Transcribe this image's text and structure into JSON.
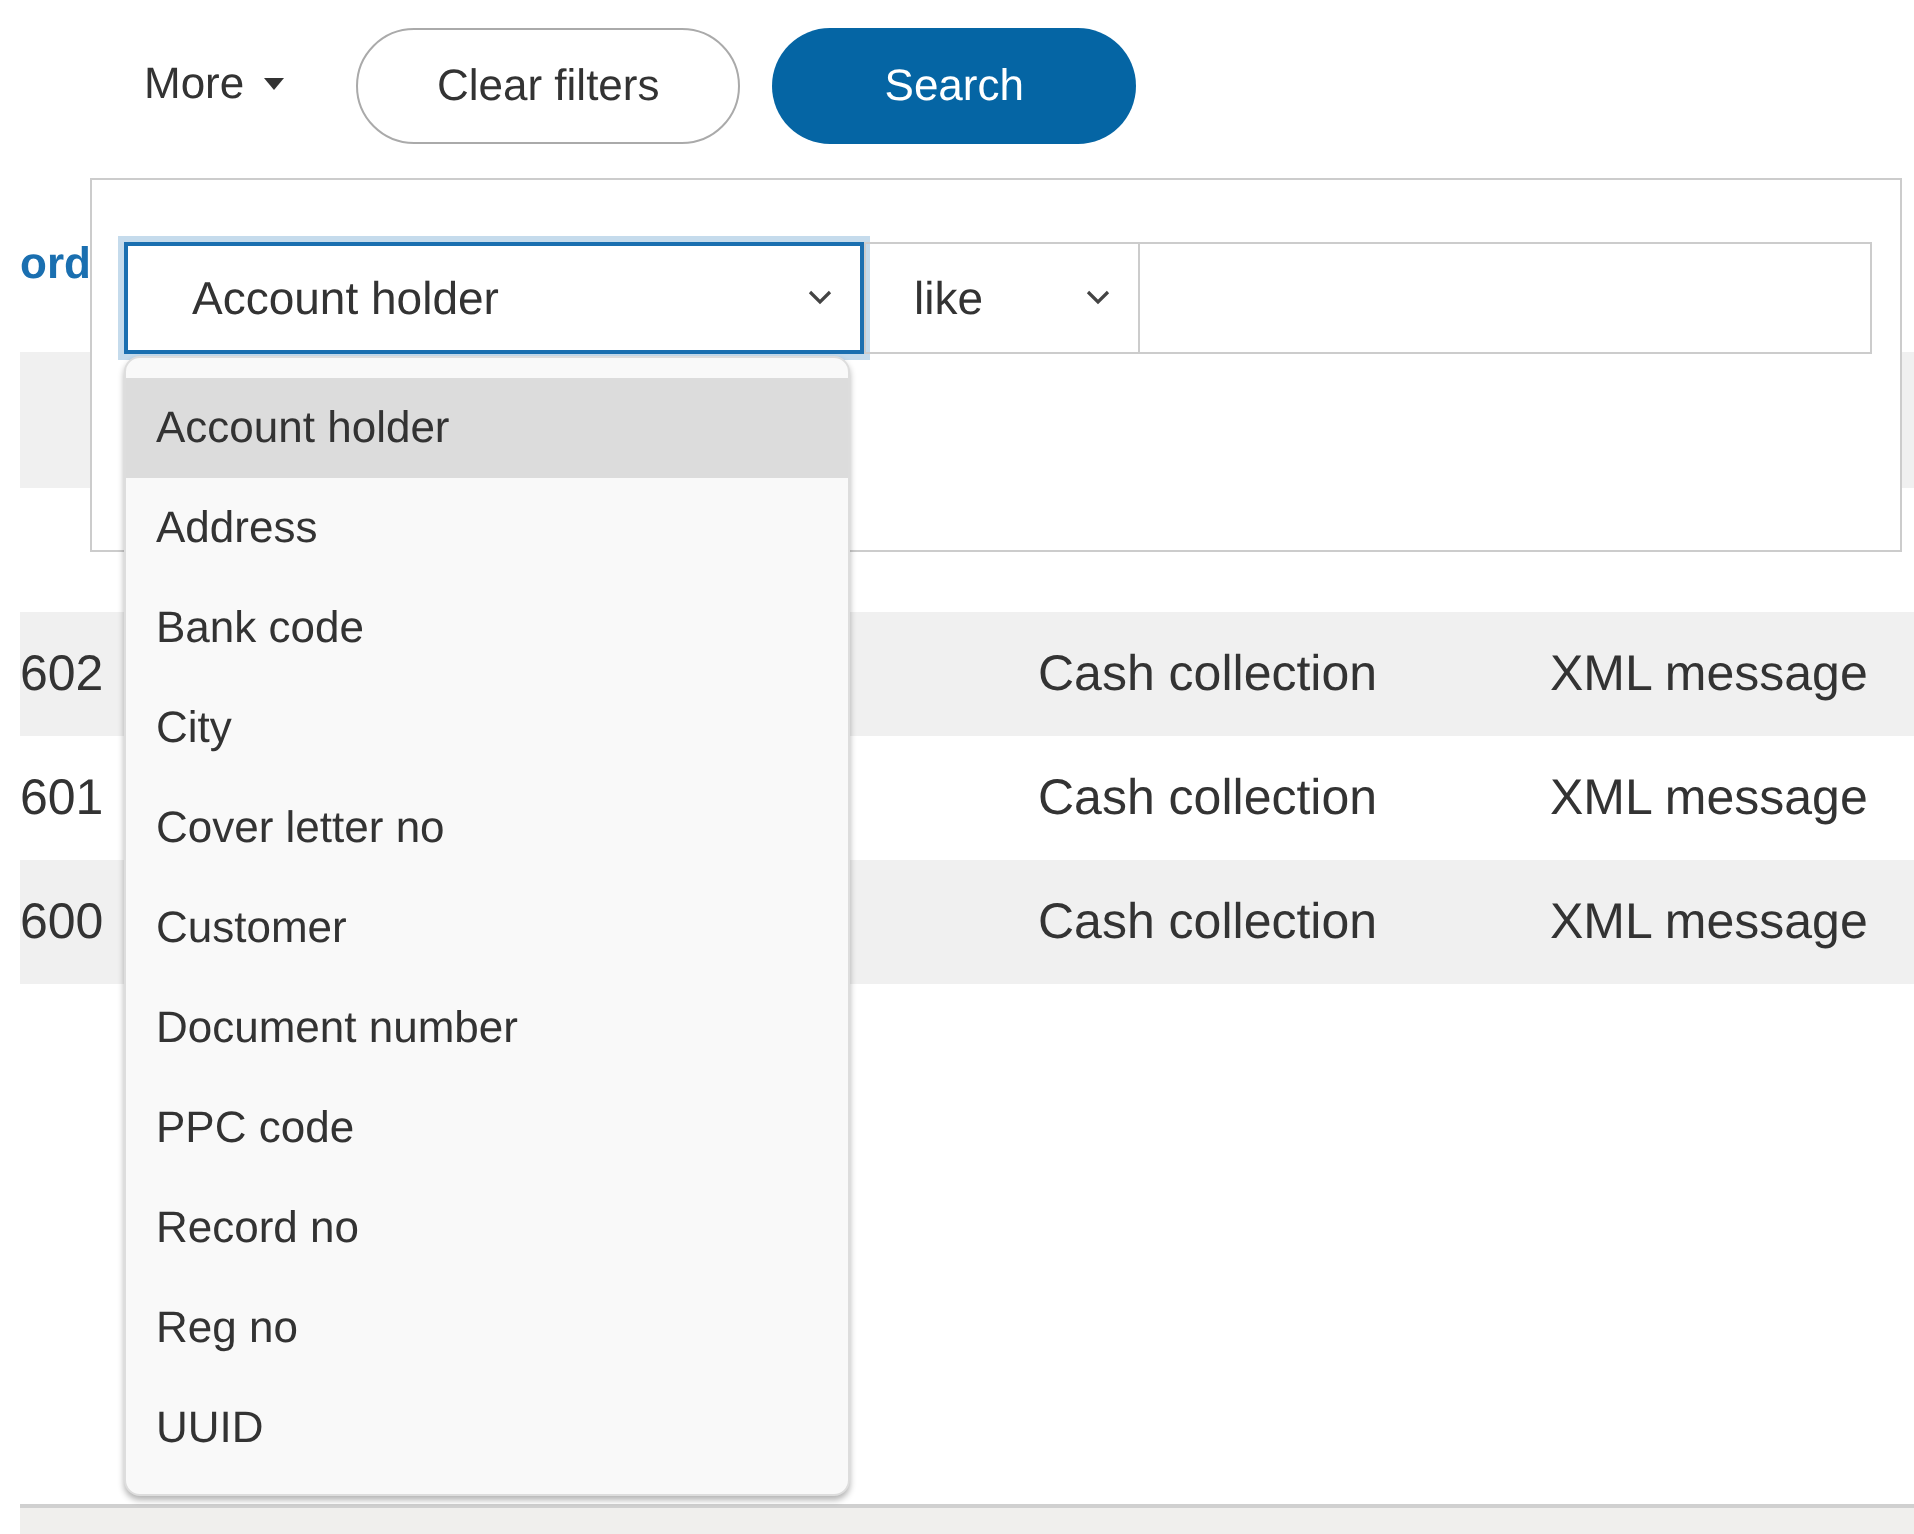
{
  "toolbar": {
    "more": {
      "label": "More"
    },
    "buttons": [
      {
        "label": "Clear filters",
        "kind": "secondary"
      },
      {
        "label": "Search",
        "kind": "primary"
      }
    ]
  },
  "table": {
    "header_link": "ord",
    "rows": [
      {
        "column_1": "602",
        "column_2": "Cash collection",
        "column_3": "XML message",
        "shaded": true
      },
      {
        "column_1": "601",
        "column_2": "Cash collection",
        "column_3": "XML message",
        "shaded": false
      },
      {
        "column_1": "600",
        "column_2": "Cash collection",
        "column_3": "XML message",
        "shaded": true
      }
    ]
  },
  "filter": {
    "field": {
      "value": "Account holder",
      "open": true,
      "options": [
        {
          "label": "Account holder",
          "selected": true
        },
        {
          "label": "Address",
          "selected": false
        },
        {
          "label": "Bank code",
          "selected": false
        },
        {
          "label": "City",
          "selected": false
        },
        {
          "label": "Cover letter no",
          "selected": false
        },
        {
          "label": "Customer",
          "selected": false
        },
        {
          "label": "Document number",
          "selected": false
        },
        {
          "label": "PPC code",
          "selected": false
        },
        {
          "label": "Record no",
          "selected": false
        },
        {
          "label": "Reg no",
          "selected": false
        },
        {
          "label": "UUID",
          "selected": false
        }
      ]
    },
    "operator": {
      "value": "like"
    }
  }
}
